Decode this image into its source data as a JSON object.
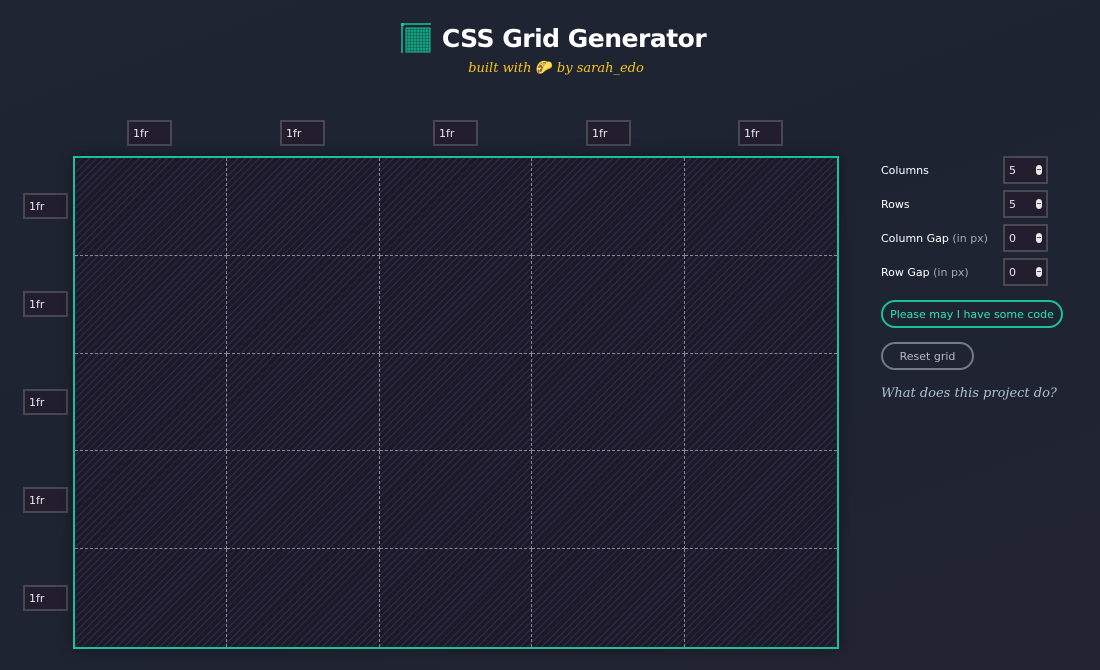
{
  "header": {
    "title": "CSS Grid Generator",
    "subtitle_prefix": "built with",
    "subtitle_emoji": "🌮",
    "subtitle_suffix": "by sarah_edo",
    "logo_icon": "grid-icon"
  },
  "column_sizes": [
    "1fr",
    "1fr",
    "1fr",
    "1fr",
    "1fr"
  ],
  "row_sizes": [
    "1fr",
    "1fr",
    "1fr",
    "1fr",
    "1fr"
  ],
  "controls": {
    "columns": {
      "label": "Columns",
      "hint": "",
      "value": "5"
    },
    "rows": {
      "label": "Rows",
      "hint": "",
      "value": "5"
    },
    "column_gap": {
      "label": "Column Gap",
      "hint": "(in px)",
      "value": "0"
    },
    "row_gap": {
      "label": "Row Gap",
      "hint": "(in px)",
      "value": "0"
    }
  },
  "buttons": {
    "code": "Please may I have some code",
    "reset": "Reset grid"
  },
  "about_link": "What does this project do?",
  "colors": {
    "accent": "#19c19a",
    "subtitle": "#f5c518",
    "background": "#1f2533",
    "grid_bg": "#1c1a2a"
  }
}
